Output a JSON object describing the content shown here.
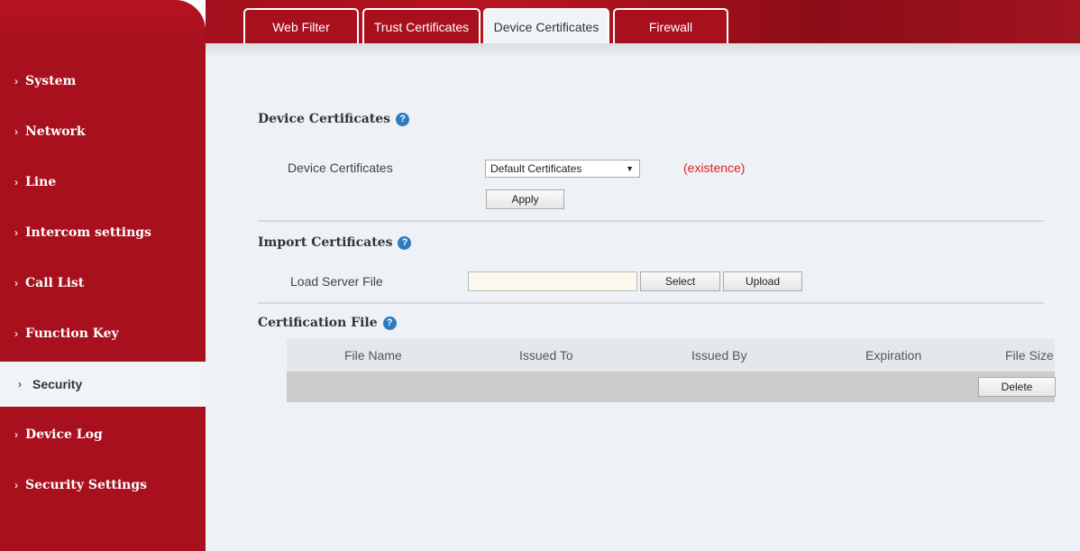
{
  "tabs": [
    {
      "label": "Web Filter"
    },
    {
      "label": "Trust Certificates"
    },
    {
      "label": "Device Certificates",
      "active": true
    },
    {
      "label": "Firewall"
    }
  ],
  "sidebar": {
    "items": [
      {
        "label": "System"
      },
      {
        "label": "Network"
      },
      {
        "label": "Line"
      },
      {
        "label": "Intercom settings"
      },
      {
        "label": "Call List"
      },
      {
        "label": "Function Key"
      },
      {
        "label": "Security",
        "active": true
      },
      {
        "label": "Device Log"
      },
      {
        "label": "Security Settings"
      }
    ],
    "chevron": "›"
  },
  "device_cert": {
    "title": "Device Certificates",
    "field_label": "Device Certificates",
    "select_value": "Default Certificates",
    "status": "(existence)",
    "apply_label": "Apply"
  },
  "import_cert": {
    "title": "Import Certificates",
    "field_label": "Load Server File",
    "file_value": "",
    "select_label": "Select",
    "upload_label": "Upload"
  },
  "cert_file": {
    "title": "Certification File",
    "columns": [
      "File Name",
      "Issued To",
      "Issued By",
      "Expiration",
      "File Size"
    ],
    "delete_label": "Delete"
  },
  "icons": {
    "help": "?",
    "dropdown": "▼"
  },
  "colors": {
    "brand_red": "#a8101e",
    "status_red": "#e02020",
    "help_blue": "#2a7cbf",
    "content_bg": "#eef2f6"
  }
}
